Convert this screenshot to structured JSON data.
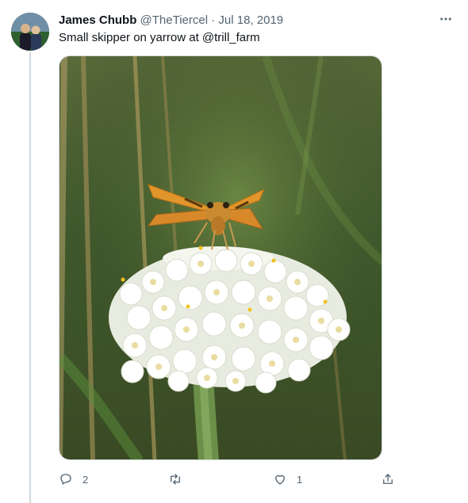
{
  "tweet": {
    "author_name": "James Chubb",
    "handle": "@TheTiercel",
    "separator": "·",
    "date": "Jul 18, 2019",
    "text": "Small skipper on yarrow at @trill_farm"
  },
  "actions": {
    "reply_count": "2",
    "like_count": "1"
  },
  "icons": {
    "more": "more-horizontal-icon",
    "reply": "reply-icon",
    "retweet": "retweet-icon",
    "like": "heart-icon",
    "share": "share-icon"
  },
  "colors": {
    "text": "#0f1419",
    "muted": "#536471",
    "line": "#cfd9de"
  }
}
